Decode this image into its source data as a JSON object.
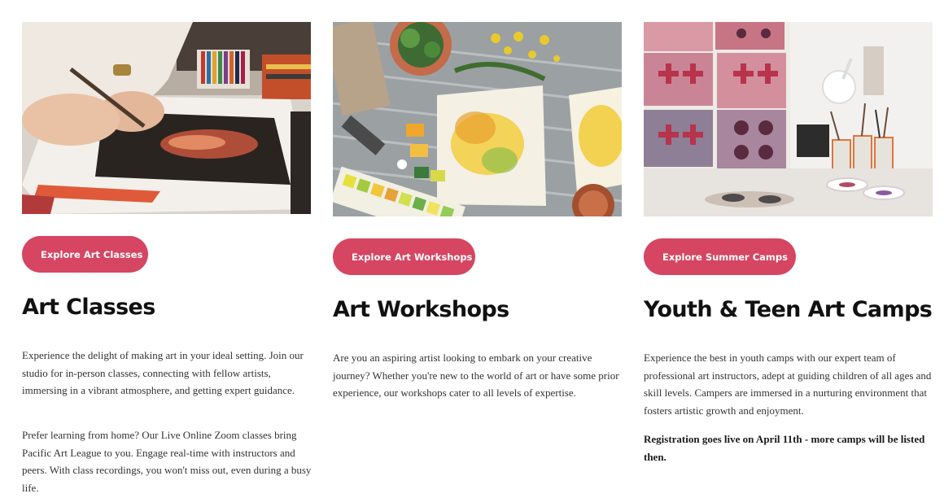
{
  "colors": {
    "accent": "#d64561",
    "heading": "#111111",
    "body_text": "#333333",
    "background": "#ffffff"
  },
  "cards": [
    {
      "photo_subject": "hands painting on paper with pastels",
      "button_label": "Explore Art Classes",
      "title": "Art Classes",
      "paragraphs": [
        "Experience the delight of making art in your ideal setting. Join our studio for in-person classes, connecting with fellow artists, immersing in a vibrant atmosphere, and getting expert guidance.",
        "Prefer learning from home? Our Live Online Zoom classes bring Pacific Art League to you. Engage real-time with instructors and peers. With class recordings, you won't miss out, even during a busy life."
      ]
    },
    {
      "photo_subject": "watercolor paintings, paint palette and flowers on a wooden table",
      "button_label": "Explore Art Workshops",
      "title": "Art Workshops",
      "paragraphs": [
        "Are you an aspiring artist looking to embark on your creative journey? Whether you're new to the world of art or have some prior experience, our workshops cater to all levels of expertise."
      ]
    },
    {
      "photo_subject": "art studio with patterned prints on wall, lamp and brushes",
      "button_label": "Explore Summer Camps",
      "title": "Youth & Teen Art Camps",
      "paragraphs": [
        "Experience the best in youth camps with our expert team of professional art instructors, adept at guiding children of all ages and skill levels. Campers are immersed in a nurturing environment that fosters artistic growth and enjoyment.",
        "Registration goes live on April 11th - more camps will be listed then."
      ]
    }
  ]
}
